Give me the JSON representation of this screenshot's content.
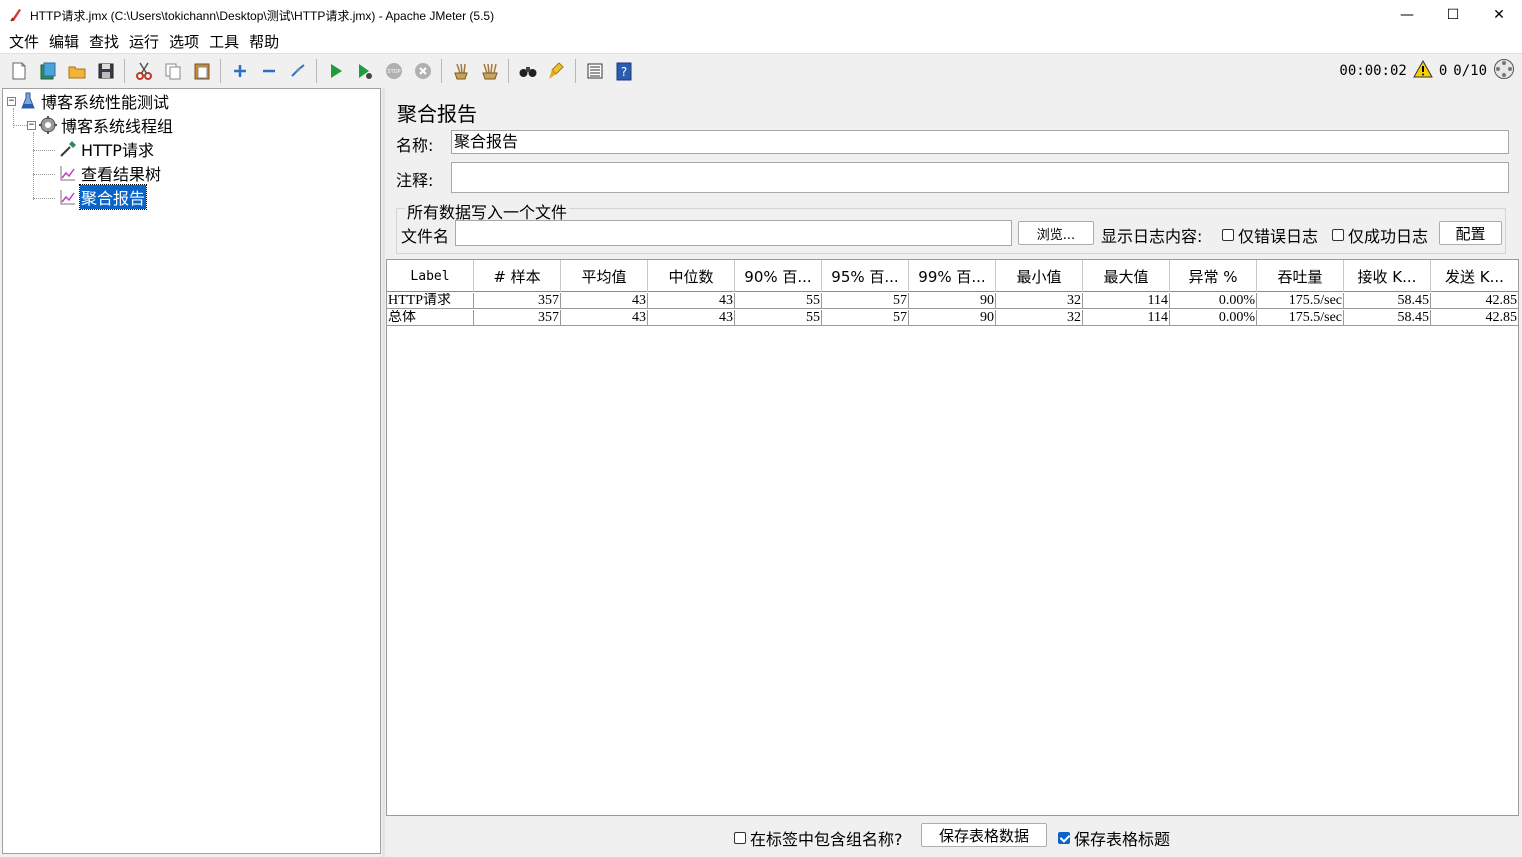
{
  "window": {
    "title": "HTTP请求.jmx (C:\\Users\\tokichann\\Desktop\\测试\\HTTP请求.jmx) - Apache JMeter (5.5)",
    "minimize": "—",
    "maximize": "☐",
    "close": "✕"
  },
  "menu": [
    "文件",
    "编辑",
    "查找",
    "运行",
    "选项",
    "工具",
    "帮助"
  ],
  "status": {
    "elapsed": "00:00:02",
    "warnings": "0",
    "threads": "0/10"
  },
  "tree": {
    "root": "博客系统性能测试",
    "thread_group": "博客系统线程组",
    "children": [
      "HTTP请求",
      "查看结果树",
      "聚合报告"
    ]
  },
  "report": {
    "title": "聚合报告",
    "name_label": "名称:",
    "name_value": "聚合报告",
    "comment_label": "注释:",
    "comment_value": "",
    "file_group_title": "所有数据写入一个文件",
    "filename_label": "文件名",
    "filename_value": "",
    "browse": "浏览...",
    "log_content_label": "显示日志内容:",
    "errors_only": "仅错误日志",
    "success_only": "仅成功日志",
    "configure": "配置"
  },
  "table": {
    "headers": [
      "Label",
      "# 样本",
      "平均值",
      "中位数",
      "90% 百...",
      "95% 百...",
      "99% 百...",
      "最小值",
      "最大值",
      "异常 %",
      "吞吐量",
      "接收 K...",
      "发送 K..."
    ],
    "rows": [
      [
        "HTTP请求",
        "357",
        "43",
        "43",
        "55",
        "57",
        "90",
        "32",
        "114",
        "0.00%",
        "175.5/sec",
        "58.45",
        "42.85"
      ],
      [
        "总体",
        "357",
        "43",
        "43",
        "55",
        "57",
        "90",
        "32",
        "114",
        "0.00%",
        "175.5/sec",
        "58.45",
        "42.85"
      ]
    ]
  },
  "bottom": {
    "include_group": "在标签中包含组名称?",
    "save_table_data": "保存表格数据",
    "save_table_header": "保存表格标题"
  }
}
